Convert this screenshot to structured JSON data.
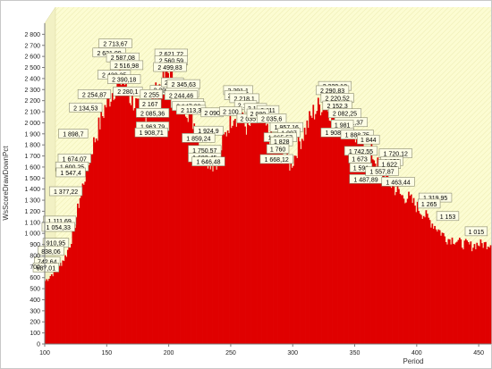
{
  "chart_data": {
    "type": "bar",
    "ylabel": "WsScoreDrawDownPct",
    "xlabel": "Period",
    "xlim": [
      100,
      460
    ],
    "ylim": [
      0,
      2900
    ],
    "x_ticks": [
      100,
      150,
      200,
      250,
      300,
      350,
      400,
      450
    ],
    "y_ticks": [
      0,
      100,
      200,
      300,
      400,
      500,
      600,
      700,
      800,
      900,
      1000,
      1100,
      1200,
      1300,
      1400,
      1500,
      1600,
      1700,
      1800,
      1900,
      2000,
      2100,
      2200,
      2300,
      2400,
      2500,
      2600,
      2700,
      2800
    ],
    "grid": false,
    "bar_color": "#e00000",
    "envelope_x": [
      100,
      104,
      108,
      112,
      116,
      120,
      124,
      128,
      132,
      136,
      140,
      144,
      148,
      152,
      156,
      160,
      164,
      168,
      172,
      176,
      180,
      184,
      188,
      192,
      196,
      200,
      204,
      208,
      212,
      216,
      220,
      224,
      228,
      232,
      236,
      240,
      244,
      248,
      252,
      256,
      260,
      264,
      268,
      272,
      276,
      280,
      284,
      288,
      292,
      296,
      300,
      304,
      308,
      312,
      316,
      320,
      324,
      328,
      332,
      336,
      340,
      344,
      348,
      352,
      356,
      360,
      364,
      368,
      372,
      376,
      380,
      384,
      388,
      392,
      396,
      400,
      404,
      408,
      412,
      416,
      420,
      424,
      428,
      432,
      436,
      440,
      444,
      448,
      452,
      456,
      460
    ],
    "envelope_y": [
      600,
      650,
      700,
      760,
      830,
      950,
      1150,
      1400,
      1600,
      1800,
      1950,
      2100,
      2250,
      2350,
      2450,
      2520,
      2480,
      2350,
      2300,
      2200,
      2150,
      2250,
      2350,
      2450,
      2550,
      2600,
      2450,
      2350,
      2300,
      2200,
      2100,
      1950,
      1800,
      1750,
      1700,
      1800,
      1950,
      2100,
      2200,
      2150,
      2100,
      2050,
      2150,
      2200,
      2100,
      2000,
      1900,
      1850,
      1800,
      1700,
      1750,
      1900,
      2000,
      2100,
      2200,
      2250,
      2300,
      2250,
      2200,
      2100,
      2050,
      2050,
      2000,
      1950,
      1900,
      1850,
      1800,
      1700,
      1650,
      1550,
      1500,
      1450,
      1400,
      1400,
      1350,
      1300,
      1250,
      1200,
      1150,
      1100,
      1050,
      1000,
      1000,
      980,
      950,
      950,
      930,
      950,
      950,
      950,
      960
    ],
    "data_labels": [
      {
        "x": 157,
        "y": 2713.67,
        "text": "2 713,67"
      },
      {
        "x": 152,
        "y": 2631.09,
        "text": "2 631,09"
      },
      {
        "x": 163,
        "y": 2587.08,
        "text": "2 587,08"
      },
      {
        "x": 166,
        "y": 2516.98,
        "text": "2 516,98"
      },
      {
        "x": 156,
        "y": 2430.25,
        "text": "2 430,25"
      },
      {
        "x": 164,
        "y": 2390.18,
        "text": "2 390,18"
      },
      {
        "x": 140,
        "y": 2254.87,
        "text": "2 254,87"
      },
      {
        "x": 133,
        "y": 2134.53,
        "text": "2 134,53"
      },
      {
        "x": 167,
        "y": 2280.1,
        "text": "2 280,1"
      },
      {
        "x": 123,
        "y": 1898.7,
        "text": "1 898,7"
      },
      {
        "x": 124,
        "y": 1674.07,
        "text": "1 674,07"
      },
      {
        "x": 122,
        "y": 1600.25,
        "text": "1 600,25"
      },
      {
        "x": 121,
        "y": 1547.4,
        "text": "1 547,4"
      },
      {
        "x": 117,
        "y": 1377.22,
        "text": "1 377,22"
      },
      {
        "x": 112,
        "y": 1111.69,
        "text": "1 111,69"
      },
      {
        "x": 111,
        "y": 1054.33,
        "text": "1 054,33"
      },
      {
        "x": 109,
        "y": 910.95,
        "text": "910,95"
      },
      {
        "x": 105,
        "y": 838.06,
        "text": "838,06"
      },
      {
        "x": 102,
        "y": 742.64,
        "text": "742,64"
      },
      {
        "x": 101,
        "y": 687.01,
        "text": "687,01"
      },
      {
        "x": 202,
        "y": 2621.72,
        "text": "2 621,72"
      },
      {
        "x": 202,
        "y": 2560.59,
        "text": "2 560,59"
      },
      {
        "x": 201,
        "y": 2499.83,
        "text": "2 499,83"
      },
      {
        "x": 194,
        "y": 2293.0,
        "text": "2 293"
      },
      {
        "x": 186,
        "y": 2255.0,
        "text": "2 255"
      },
      {
        "x": 185,
        "y": 2167.0,
        "text": "2 167"
      },
      {
        "x": 187,
        "y": 2085.36,
        "text": "2 085,36"
      },
      {
        "x": 187,
        "y": 1963.79,
        "text": "1 963,79"
      },
      {
        "x": 186,
        "y": 1908.71,
        "text": "1 908,71"
      },
      {
        "x": 203,
        "y": 2362.0,
        "text": "2 362"
      },
      {
        "x": 212,
        "y": 2345.63,
        "text": "2 345,63"
      },
      {
        "x": 211,
        "y": 2266.87,
        "text": "2 266,87"
      },
      {
        "x": 210,
        "y": 2244.46,
        "text": "2 244,46"
      },
      {
        "x": 215,
        "y": 2172.45,
        "text": "2 172,45"
      },
      {
        "x": 216,
        "y": 2147.08,
        "text": "2 147,08"
      },
      {
        "x": 218,
        "y": 2113.3,
        "text": "2 113,3"
      },
      {
        "x": 235,
        "y": 2090.0,
        "text": "2 090"
      },
      {
        "x": 232,
        "y": 1924.9,
        "text": "1 924,9"
      },
      {
        "x": 224,
        "y": 1859.24,
        "text": "1 859,24"
      },
      {
        "x": 229,
        "y": 1750.57,
        "text": "1 750,57"
      },
      {
        "x": 229,
        "y": 1682.45,
        "text": "1 682,45"
      },
      {
        "x": 232,
        "y": 1646.48,
        "text": "1 646,48"
      },
      {
        "x": 256,
        "y": 2291.1,
        "text": "2 291,1"
      },
      {
        "x": 254,
        "y": 2245.0,
        "text": "2 245"
      },
      {
        "x": 261,
        "y": 2218.1,
        "text": "2 218,1"
      },
      {
        "x": 262,
        "y": 2155.0,
        "text": "2 155"
      },
      {
        "x": 250,
        "y": 2100.0,
        "text": "2 100"
      },
      {
        "x": 270,
        "y": 2130.0,
        "text": "2 130"
      },
      {
        "x": 264,
        "y": 2035.0,
        "text": "2 035"
      },
      {
        "x": 280,
        "y": 2111.0,
        "text": "2 111"
      },
      {
        "x": 272,
        "y": 2080.0,
        "text": "2 080"
      },
      {
        "x": 283,
        "y": 2035.6,
        "text": "2 035,6"
      },
      {
        "x": 295,
        "y": 1957.16,
        "text": "1 957,16"
      },
      {
        "x": 297,
        "y": 1907.0,
        "text": "1 907"
      },
      {
        "x": 290,
        "y": 1865.57,
        "text": "1 865,57"
      },
      {
        "x": 291,
        "y": 1828.0,
        "text": "1 828"
      },
      {
        "x": 288,
        "y": 1760.0,
        "text": "1 760"
      },
      {
        "x": 287,
        "y": 1668.12,
        "text": "1 668,12"
      },
      {
        "x": 334,
        "y": 2329.18,
        "text": "2 329,18"
      },
      {
        "x": 332,
        "y": 2290.83,
        "text": "2 290,83"
      },
      {
        "x": 336,
        "y": 2220.52,
        "text": "2 220,52"
      },
      {
        "x": 336,
        "y": 2152.3,
        "text": "2 152,3"
      },
      {
        "x": 342,
        "y": 2082.25,
        "text": "2 082,25"
      },
      {
        "x": 347,
        "y": 2001.37,
        "text": "2 001,37"
      },
      {
        "x": 340,
        "y": 1981.0,
        "text": "1 981"
      },
      {
        "x": 336,
        "y": 1908.55,
        "text": "1 908,55"
      },
      {
        "x": 352,
        "y": 1888.75,
        "text": "1 888,75"
      },
      {
        "x": 361,
        "y": 1844.0,
        "text": "1 844"
      },
      {
        "x": 355,
        "y": 1742.55,
        "text": "1 742,55"
      },
      {
        "x": 354,
        "y": 1673.0,
        "text": "1 673"
      },
      {
        "x": 355,
        "y": 1591.0,
        "text": "1 591"
      },
      {
        "x": 359,
        "y": 1487.89,
        "text": "1 487,89"
      },
      {
        "x": 383,
        "y": 1720.12,
        "text": "1 720,12"
      },
      {
        "x": 380,
        "y": 1650.0,
        "text": "1 650"
      },
      {
        "x": 378,
        "y": 1622.0,
        "text": "1 622"
      },
      {
        "x": 372,
        "y": 1557.87,
        "text": "1 557,87"
      },
      {
        "x": 385,
        "y": 1463.44,
        "text": "1 463,44"
      },
      {
        "x": 415,
        "y": 1319.95,
        "text": "1 319,95"
      },
      {
        "x": 410,
        "y": 1265.0,
        "text": "1 265"
      },
      {
        "x": 425,
        "y": 1153.0,
        "text": "1 153"
      },
      {
        "x": 448,
        "y": 1015.0,
        "text": "1 015"
      }
    ]
  }
}
